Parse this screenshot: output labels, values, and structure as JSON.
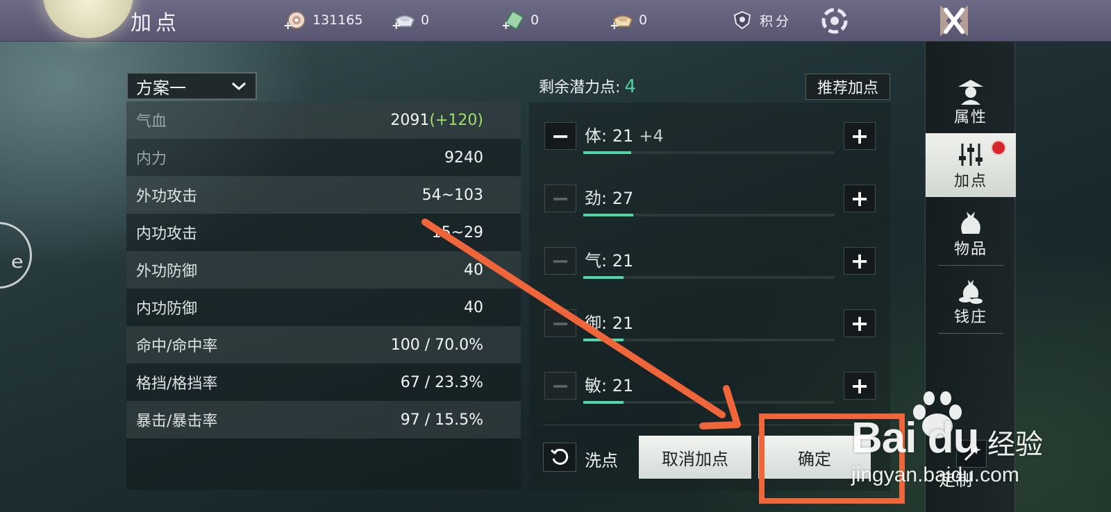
{
  "header": {
    "title": "加点",
    "currencies": [
      {
        "icon": "coin-icon",
        "value": "131165"
      },
      {
        "icon": "silver-ingot-icon",
        "value": "0"
      },
      {
        "icon": "jade-ticket-icon",
        "value": "0"
      },
      {
        "icon": "gold-ingot-icon",
        "value": "0"
      }
    ],
    "points_label": "积分",
    "close_icon": "close-icon"
  },
  "plan_selector": {
    "selected": "方案一"
  },
  "stats": [
    {
      "label": "气血",
      "value": "2091",
      "bonus": "(+120)"
    },
    {
      "label": "内力",
      "value": "9240",
      "bonus": ""
    },
    {
      "label": "外功攻击",
      "value": "54~103",
      "bonus": ""
    },
    {
      "label": "内功攻击",
      "value": "15~29",
      "bonus": ""
    },
    {
      "label": "外功防御",
      "value": "40",
      "bonus": ""
    },
    {
      "label": "内功防御",
      "value": "40",
      "bonus": ""
    },
    {
      "label": "命中/命中率",
      "value": "100 / 70.0%",
      "bonus": ""
    },
    {
      "label": "格挡/格挡率",
      "value": "67 / 23.3%",
      "bonus": ""
    },
    {
      "label": "暴击/暴击率",
      "value": "97 / 15.5%",
      "bonus": ""
    }
  ],
  "allocation": {
    "remaining_label": "剩余潜力点:",
    "remaining_value": "4",
    "recommend_label": "推荐加点",
    "attributes": [
      {
        "name": "体",
        "sep": ":",
        "value": "21",
        "added": "+4",
        "fill": 0.19,
        "minus_enabled": true
      },
      {
        "name": "劲",
        "sep": ":",
        "value": "27",
        "added": "",
        "fill": 0.2,
        "minus_enabled": false
      },
      {
        "name": "气",
        "sep": ":",
        "value": "21",
        "added": "",
        "fill": 0.16,
        "minus_enabled": false
      },
      {
        "name": "御",
        "sep": ":",
        "value": "21",
        "added": "",
        "fill": 0.16,
        "minus_enabled": false
      },
      {
        "name": "敏",
        "sep": ":",
        "value": "21",
        "added": "",
        "fill": 0.16,
        "minus_enabled": false
      }
    ],
    "reset_label": "洗点",
    "cancel_label": "取消加点",
    "confirm_label": "确定"
  },
  "sidebar": {
    "items": [
      {
        "label": "属性",
        "icon": "character-icon"
      },
      {
        "label": "加点",
        "icon": "sliders-icon"
      },
      {
        "label": "物品",
        "icon": "bag-icon"
      },
      {
        "label": "钱庄",
        "icon": "money-bag-icon"
      }
    ],
    "active_index": 1,
    "customize_label": "定制"
  },
  "watermark": {
    "logo": "Bai du",
    "jingyan": "经验",
    "url": "jingyan.baidu.com"
  },
  "colors": {
    "accent": "#52d6a8",
    "bonus": "#9ee06a",
    "highlight": "#f0663a",
    "notification": "#d6262a"
  }
}
